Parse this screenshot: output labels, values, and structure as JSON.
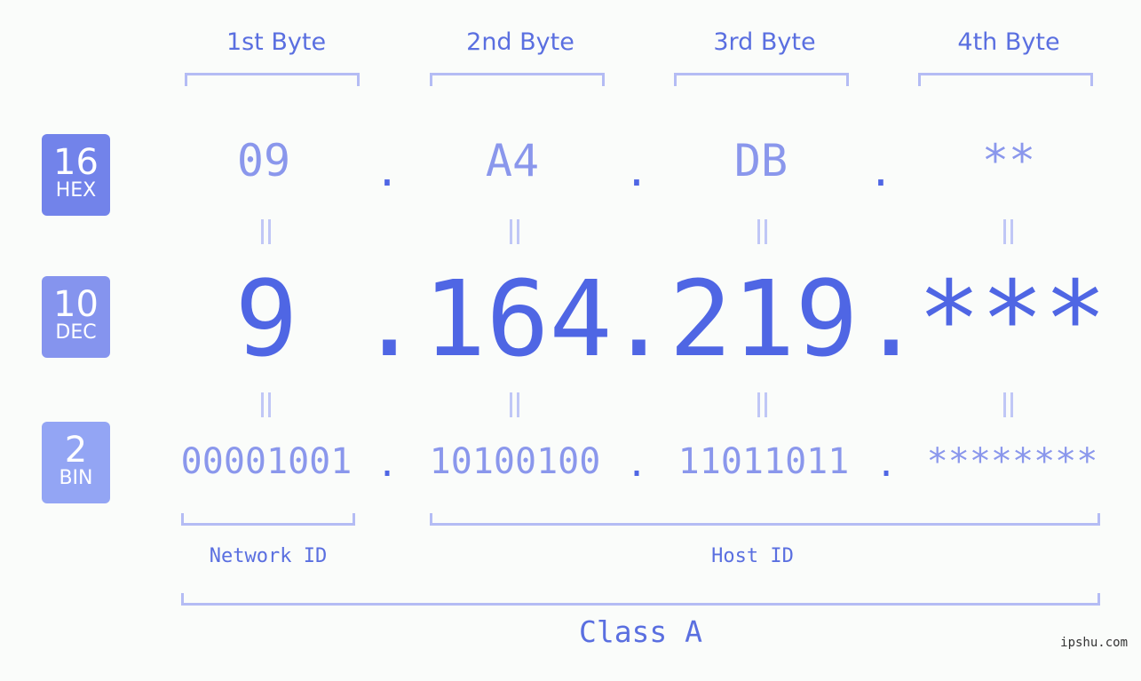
{
  "bytes": [
    {
      "label": "1st Byte",
      "hex": "09",
      "dec": "9",
      "bin": "00001001"
    },
    {
      "label": "2nd Byte",
      "hex": "A4",
      "dec": "164",
      "bin": "10100100"
    },
    {
      "label": "3rd Byte",
      "hex": "DB",
      "dec": "219",
      "bin": "11011011"
    },
    {
      "label": "4th Byte",
      "hex": "**",
      "dec": "***",
      "bin": "********"
    }
  ],
  "separator": ".",
  "badges": {
    "hex": {
      "num": "16",
      "unit": "HEX",
      "color": "#7283ea"
    },
    "dec": {
      "num": "10",
      "unit": "DEC",
      "color": "#8594ee"
    },
    "bin": {
      "num": "2",
      "unit": "BIN",
      "color": "#93a5f4"
    }
  },
  "ids": {
    "network": "Network ID",
    "host": "Host ID"
  },
  "class_label": "Class A",
  "watermark": "ipshu.com",
  "colors": {
    "accent": "#4f66e4",
    "light": "#8a97ec",
    "bracket": "#b4bcf4"
  }
}
